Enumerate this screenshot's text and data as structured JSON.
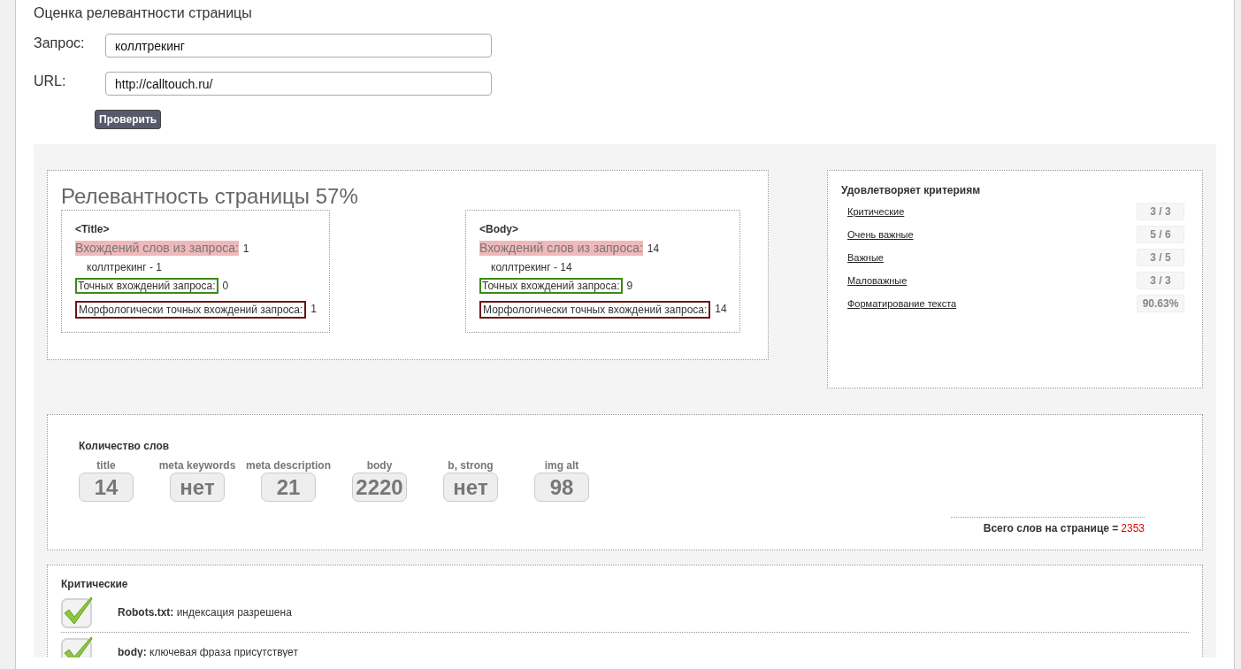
{
  "page_title": "Оценка релевантности страницы",
  "form": {
    "fields": [
      {
        "label": "Запрос:",
        "value": "коллтрекинг"
      },
      {
        "label": "URL:",
        "value": "http://calltouch.ru/"
      }
    ],
    "button": "Проверить"
  },
  "relevance": {
    "title": "Релевантность страницы 57%",
    "sections": [
      {
        "heading": "<Title>",
        "rows": [
          {
            "kind": "query_words",
            "label": "Вхождений слов из запроса:",
            "value": "1"
          },
          {
            "kind": "word",
            "label": "коллтрекинг - 1"
          },
          {
            "kind": "exact",
            "label": "Точных вхождений запроса:",
            "value": "0"
          },
          {
            "kind": "morph",
            "label": "Морфологически точных вхождений запроса:",
            "value": "1"
          }
        ]
      },
      {
        "heading": "<Body>",
        "rows": [
          {
            "kind": "query_words",
            "label": "Вхождений слов из запроса:",
            "value": "14"
          },
          {
            "kind": "word",
            "label": "коллтрекинг - 14"
          },
          {
            "kind": "exact",
            "label": "Точных вхождений запроса:",
            "value": "9"
          },
          {
            "kind": "morph",
            "label": "Морфологически точных вхождений запроса:",
            "value": "14"
          }
        ]
      }
    ]
  },
  "criteria": {
    "title": "Удовлетворяет критериям",
    "items": [
      {
        "label": "Критические",
        "value": "3 / 3"
      },
      {
        "label": "Очень важные",
        "value": "5 / 6"
      },
      {
        "label": "Важные",
        "value": "3 / 5"
      },
      {
        "label": "Маловажные",
        "value": "3 / 3"
      },
      {
        "label": "Форматирование текста",
        "value": "90.63%"
      }
    ]
  },
  "word_count": {
    "title": "Количество слов",
    "items": [
      {
        "label": "title",
        "value": "14"
      },
      {
        "label": "meta keywords",
        "value": "нет"
      },
      {
        "label": "meta description",
        "value": "21"
      },
      {
        "label": "body",
        "value": "2220"
      },
      {
        "label": "b, strong",
        "value": "нет"
      },
      {
        "label": "img alt",
        "value": "98"
      }
    ],
    "total_label": "Всего слов на странице =",
    "total": "2353"
  },
  "checks": {
    "title": "Критические",
    "items": [
      {
        "passed": true,
        "name": "Robots.txt:",
        "text": "индексация разрешена"
      },
      {
        "passed": true,
        "name": "body:",
        "text": "ключевая фраза присутствует"
      }
    ]
  }
}
